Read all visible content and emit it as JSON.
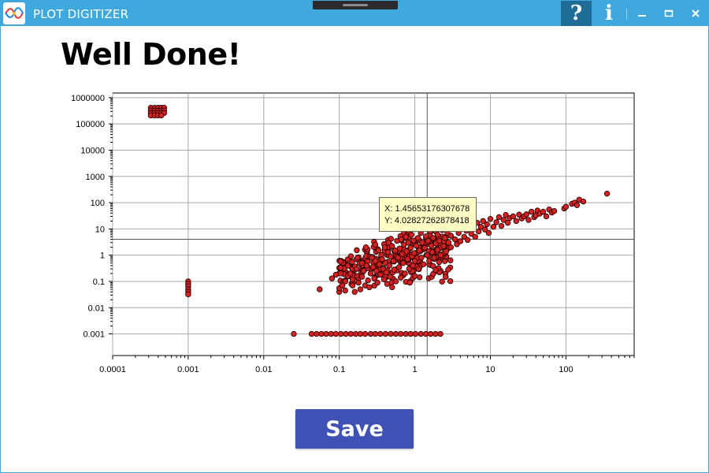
{
  "window": {
    "title": "PLOT DIGITIZER",
    "title_bar_color": "#3fa9de",
    "buttons": {
      "help_label": "?",
      "info_label": "i",
      "minimize_icon": "minimize-icon",
      "maximize_icon": "maximize-icon",
      "close_icon": "close-icon"
    }
  },
  "main": {
    "heading": "Well Done!",
    "save_label": "Save",
    "save_color": "#3f51b5"
  },
  "tooltip": {
    "x_text": "X: 1.45653176307678",
    "y_text": "Y: 4.02827262878418"
  },
  "chart_data": {
    "type": "scatter",
    "x_scale": "log",
    "y_scale": "log",
    "xlim": [
      0.0001,
      800
    ],
    "ylim": [
      0.00015,
      1500000
    ],
    "x_ticks": [
      "0.0001",
      "0.001",
      "0.01",
      "0.1",
      "1",
      "10",
      "100"
    ],
    "y_ticks": [
      "0.001",
      "0.01",
      "0.1",
      "1",
      "10",
      "100",
      "1000",
      "10000",
      "100000",
      "1000000"
    ],
    "grid": true,
    "marker_color": "#d42020",
    "crosshair": {
      "x": 1.45653176307678,
      "y": 4.02827262878418
    },
    "points": [
      [
        0.00032,
        410000
      ],
      [
        0.00036,
        410000
      ],
      [
        0.0004,
        410000
      ],
      [
        0.00044,
        410000
      ],
      [
        0.00048,
        410000
      ],
      [
        0.00032,
        320000
      ],
      [
        0.00036,
        320000
      ],
      [
        0.0004,
        320000
      ],
      [
        0.00044,
        320000
      ],
      [
        0.00048,
        320000
      ],
      [
        0.00032,
        260000
      ],
      [
        0.00036,
        260000
      ],
      [
        0.0004,
        260000
      ],
      [
        0.00044,
        260000
      ],
      [
        0.00048,
        260000
      ],
      [
        0.00032,
        210000
      ],
      [
        0.00036,
        210000
      ],
      [
        0.0004,
        210000
      ],
      [
        0.00044,
        210000
      ],
      [
        0.001,
        0.1
      ],
      [
        0.001,
        0.08
      ],
      [
        0.001,
        0.065
      ],
      [
        0.001,
        0.05
      ],
      [
        0.001,
        0.04
      ],
      [
        0.001,
        0.032
      ],
      [
        0.025,
        0.001
      ],
      [
        0.043,
        0.001
      ],
      [
        0.05,
        0.001
      ],
      [
        0.058,
        0.001
      ],
      [
        0.067,
        0.001
      ],
      [
        0.078,
        0.001
      ],
      [
        0.09,
        0.001
      ],
      [
        0.105,
        0.001
      ],
      [
        0.122,
        0.001
      ],
      [
        0.142,
        0.001
      ],
      [
        0.165,
        0.001
      ],
      [
        0.19,
        0.001
      ],
      [
        0.22,
        0.001
      ],
      [
        0.26,
        0.001
      ],
      [
        0.3,
        0.001
      ],
      [
        0.35,
        0.001
      ],
      [
        0.41,
        0.001
      ],
      [
        0.48,
        0.001
      ],
      [
        0.56,
        0.001
      ],
      [
        0.65,
        0.001
      ],
      [
        0.76,
        0.001
      ],
      [
        0.88,
        0.001
      ],
      [
        1.02,
        0.001
      ],
      [
        1.2,
        0.001
      ],
      [
        1.4,
        0.001
      ],
      [
        1.62,
        0.001
      ],
      [
        1.88,
        0.001
      ],
      [
        2.18,
        0.001
      ],
      [
        0.055,
        0.05
      ],
      [
        0.08,
        0.13
      ],
      [
        0.09,
        0.18
      ],
      [
        0.1,
        0.04
      ],
      [
        0.1,
        0.055
      ],
      [
        0.11,
        0.07
      ],
      [
        0.12,
        0.1
      ],
      [
        0.12,
        0.045
      ],
      [
        0.13,
        0.16
      ],
      [
        0.14,
        0.2
      ],
      [
        0.15,
        0.07
      ],
      [
        0.15,
        0.12
      ],
      [
        0.16,
        0.04
      ],
      [
        0.17,
        0.3
      ],
      [
        0.18,
        0.09
      ],
      [
        0.19,
        0.05
      ],
      [
        0.2,
        0.5
      ],
      [
        0.2,
        0.15
      ],
      [
        0.21,
        0.25
      ],
      [
        0.22,
        0.07
      ],
      [
        0.23,
        0.4
      ],
      [
        0.24,
        0.11
      ],
      [
        0.25,
        0.06
      ],
      [
        0.26,
        0.2
      ],
      [
        0.27,
        0.8
      ],
      [
        0.28,
        0.35
      ],
      [
        0.29,
        0.13
      ],
      [
        0.3,
        2.5
      ],
      [
        0.3,
        0.6
      ],
      [
        0.31,
        0.25
      ],
      [
        0.32,
        0.09
      ],
      [
        0.33,
        1.5
      ],
      [
        0.34,
        0.45
      ],
      [
        0.35,
        0.18
      ],
      [
        0.36,
        1.0
      ],
      [
        0.37,
        0.7
      ],
      [
        0.38,
        0.3
      ],
      [
        0.39,
        0.12
      ],
      [
        0.4,
        2.0
      ],
      [
        0.41,
        0.5
      ],
      [
        0.42,
        0.22
      ],
      [
        0.43,
        0.08
      ],
      [
        0.44,
        1.3
      ],
      [
        0.45,
        3.0
      ],
      [
        0.46,
        0.4
      ],
      [
        0.47,
        0.15
      ],
      [
        0.48,
        0.9
      ],
      [
        0.5,
        0.06
      ],
      [
        0.5,
        2.2
      ],
      [
        0.52,
        0.6
      ],
      [
        0.53,
        0.28
      ],
      [
        0.55,
        1.5
      ],
      [
        0.56,
        0.1
      ],
      [
        0.58,
        3.5
      ],
      [
        0.6,
        0.8
      ],
      [
        0.62,
        0.35
      ],
      [
        0.63,
        1.8
      ],
      [
        0.65,
        0.14
      ],
      [
        0.66,
        4.0
      ],
      [
        0.68,
        1.1
      ],
      [
        0.7,
        0.5
      ],
      [
        0.72,
        2.5
      ],
      [
        0.74,
        0.2
      ],
      [
        0.76,
        5.0
      ],
      [
        0.78,
        1.4
      ],
      [
        0.8,
        0.7
      ],
      [
        0.82,
        3.0
      ],
      [
        0.84,
        0.3
      ],
      [
        0.86,
        0.09
      ],
      [
        0.88,
        1.9
      ],
      [
        0.9,
        6.0
      ],
      [
        0.92,
        0.9
      ],
      [
        0.94,
        0.4
      ],
      [
        0.96,
        3.6
      ],
      [
        0.98,
        1.2
      ],
      [
        1.0,
        0.16
      ],
      [
        1.0,
        0.6
      ],
      [
        1.05,
        2.3
      ],
      [
        1.1,
        4.5
      ],
      [
        1.12,
        0.3
      ],
      [
        1.15,
        1.5
      ],
      [
        1.2,
        7.0
      ],
      [
        1.22,
        0.8
      ],
      [
        1.25,
        3.0
      ],
      [
        1.3,
        0.45
      ],
      [
        1.35,
        1.9
      ],
      [
        1.4,
        5.2
      ],
      [
        1.45,
        1.0
      ],
      [
        1.5,
        3.5
      ],
      [
        1.55,
        0.6
      ],
      [
        1.6,
        8.0
      ],
      [
        1.65,
        2.3
      ],
      [
        1.7,
        1.3
      ],
      [
        1.75,
        4.5
      ],
      [
        1.8,
        0.8
      ],
      [
        1.9,
        2.8
      ],
      [
        2.0,
        6.0
      ],
      [
        2.0,
        1.6
      ],
      [
        2.1,
        3.5
      ],
      [
        2.2,
        1.0
      ],
      [
        2.3,
        9.0
      ],
      [
        2.4,
        2.2
      ],
      [
        2.5,
        4.5
      ],
      [
        2.6,
        1.4
      ],
      [
        2.7,
        7.0
      ],
      [
        2.8,
        3.0
      ],
      [
        3.0,
        5.5
      ],
      [
        3.0,
        2.0
      ],
      [
        3.2,
        10.0
      ],
      [
        3.4,
        4.0
      ],
      [
        3.6,
        2.6
      ],
      [
        3.8,
        7.0
      ],
      [
        4.0,
        3.4
      ],
      [
        4.2,
        12.0
      ],
      [
        4.5,
        5.0
      ],
      [
        4.8,
        8.5
      ],
      [
        5.0,
        3.8
      ],
      [
        5.3,
        14.0
      ],
      [
        5.6,
        6.5
      ],
      [
        6.0,
        10.0
      ],
      [
        6.3,
        5.0
      ],
      [
        6.7,
        17.0
      ],
      [
        7.0,
        8.0
      ],
      [
        7.5,
        12.0
      ],
      [
        8.0,
        20.0
      ],
      [
        8.5,
        9.5
      ],
      [
        9.0,
        15.0
      ],
      [
        9.5,
        7.0
      ],
      [
        10,
        24.0
      ],
      [
        11,
        12.0
      ],
      [
        12,
        18.0
      ],
      [
        13,
        28.0
      ],
      [
        14,
        13.0
      ],
      [
        15,
        22.0
      ],
      [
        16,
        34.0
      ],
      [
        17,
        17.0
      ],
      [
        18,
        26.0
      ],
      [
        20,
        30.0
      ],
      [
        22,
        20.0
      ],
      [
        24,
        35.0
      ],
      [
        26,
        25.0
      ],
      [
        28,
        30.0
      ],
      [
        30,
        36.0
      ],
      [
        32,
        22.0
      ],
      [
        35,
        45.0
      ],
      [
        38,
        28.0
      ],
      [
        40,
        33.0
      ],
      [
        42,
        50.0
      ],
      [
        45,
        38.0
      ],
      [
        50,
        45.0
      ],
      [
        55,
        30.0
      ],
      [
        60,
        55.0
      ],
      [
        65,
        42.0
      ],
      [
        70,
        48.0
      ],
      [
        95,
        60.0
      ],
      [
        100,
        70.0
      ],
      [
        120,
        90.0
      ],
      [
        130,
        100.0
      ],
      [
        140,
        80.0
      ],
      [
        150,
        130.0
      ],
      [
        170,
        110.0
      ],
      [
        350,
        220.0
      ]
    ],
    "cluster": {
      "x_range": [
        0.1,
        3.0
      ],
      "y_center": [
        0.25,
        2.0
      ],
      "spread": [
        0.55,
        1.5
      ],
      "count": 260
    }
  }
}
